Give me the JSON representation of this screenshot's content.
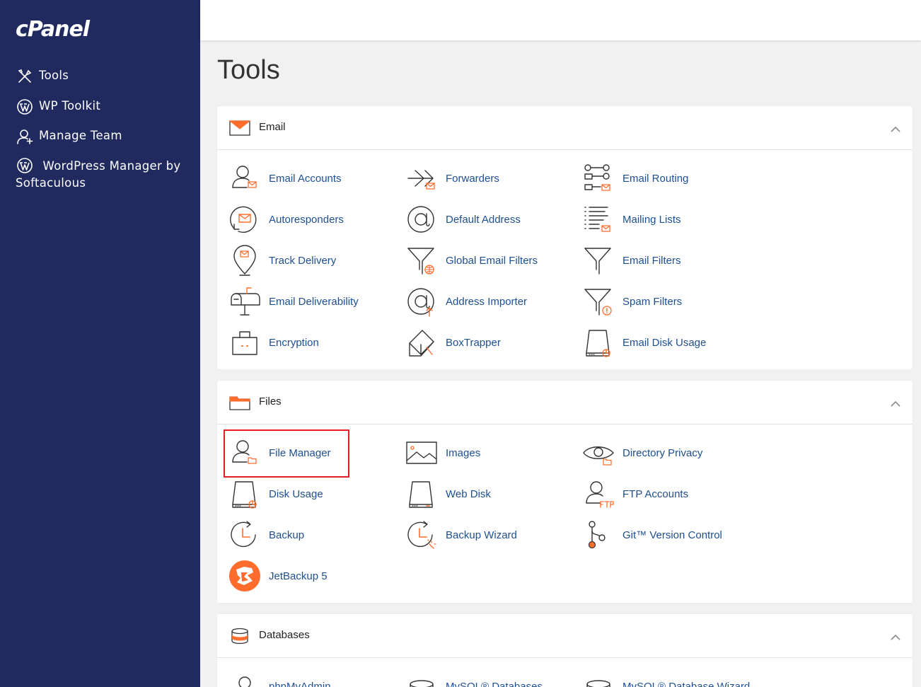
{
  "sidebar": {
    "logo": "cPanel",
    "items": [
      {
        "label": "Tools",
        "icon": "tools-icon"
      },
      {
        "label": "WP Toolkit",
        "icon": "wordpress-icon"
      },
      {
        "label": "Manage Team",
        "icon": "manage-team-icon"
      },
      {
        "label": "WordPress Manager by Softaculous",
        "icon": "wordpress-icon"
      }
    ]
  },
  "page": {
    "title": "Tools"
  },
  "colors": {
    "sidebar": "#202a5f",
    "accent": "#ff6c2c",
    "link": "#1d4f91",
    "highlight": "#e81c24"
  },
  "sections": {
    "email": {
      "title": "Email",
      "items": [
        {
          "label": "Email Accounts",
          "icon": "email-accounts-icon"
        },
        {
          "label": "Forwarders",
          "icon": "forwarders-icon"
        },
        {
          "label": "Email Routing",
          "icon": "email-routing-icon"
        },
        {
          "label": "Autoresponders",
          "icon": "autoresponders-icon"
        },
        {
          "label": "Default Address",
          "icon": "default-address-icon"
        },
        {
          "label": "Mailing Lists",
          "icon": "mailing-lists-icon"
        },
        {
          "label": "Track Delivery",
          "icon": "track-delivery-icon"
        },
        {
          "label": "Global Email Filters",
          "icon": "global-email-filters-icon"
        },
        {
          "label": "Email Filters",
          "icon": "email-filters-icon"
        },
        {
          "label": "Email Deliverability",
          "icon": "email-deliverability-icon"
        },
        {
          "label": "Address Importer",
          "icon": "address-importer-icon"
        },
        {
          "label": "Spam Filters",
          "icon": "spam-filters-icon"
        },
        {
          "label": "Encryption",
          "icon": "encryption-icon"
        },
        {
          "label": "BoxTrapper",
          "icon": "boxtrapper-icon"
        },
        {
          "label": "Email Disk Usage",
          "icon": "email-disk-usage-icon"
        }
      ]
    },
    "files": {
      "title": "Files",
      "items": [
        {
          "label": "File Manager",
          "icon": "file-manager-icon"
        },
        {
          "label": "Images",
          "icon": "images-icon"
        },
        {
          "label": "Directory Privacy",
          "icon": "directory-privacy-icon"
        },
        {
          "label": "Disk Usage",
          "icon": "disk-usage-icon"
        },
        {
          "label": "Web Disk",
          "icon": "web-disk-icon"
        },
        {
          "label": "FTP Accounts",
          "icon": "ftp-accounts-icon"
        },
        {
          "label": "Backup",
          "icon": "backup-icon"
        },
        {
          "label": "Backup Wizard",
          "icon": "backup-wizard-icon"
        },
        {
          "label": "Git™ Version Control",
          "icon": "git-version-control-icon"
        },
        {
          "label": "JetBackup 5",
          "icon": "jetbackup-icon"
        }
      ]
    },
    "databases": {
      "title": "Databases",
      "items": [
        {
          "label": "phpMyAdmin",
          "icon": "phpmyadmin-icon"
        },
        {
          "label": "MySQL® Databases",
          "icon": "mysql-databases-icon"
        },
        {
          "label": "MySQL® Database Wizard",
          "icon": "mysql-database-wizard-icon"
        }
      ]
    }
  }
}
